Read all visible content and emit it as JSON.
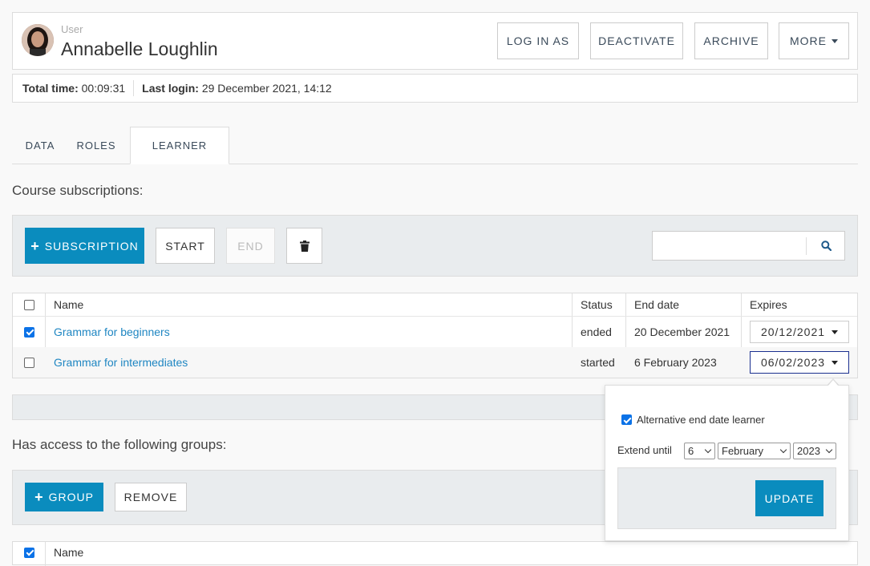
{
  "header": {
    "kicker": "User",
    "name": "Annabelle Loughlin",
    "buttons": {
      "login_as": "LOG IN AS",
      "deactivate": "DEACTIVATE",
      "archive": "ARCHIVE",
      "more": "MORE"
    }
  },
  "info": {
    "total_time_label": "Total time:",
    "total_time_value": "00:09:31",
    "last_login_label": "Last login:",
    "last_login_value": "29 December 2021, 14:12"
  },
  "tabs": {
    "data": "DATA",
    "roles": "ROLES",
    "learner": "LEARNER",
    "active": "LEARNER"
  },
  "subscriptions": {
    "title": "Course subscriptions:",
    "add_label": "SUBSCRIPTION",
    "start_label": "START",
    "end_label": "END",
    "search_placeholder": "",
    "columns": {
      "name": "Name",
      "status": "Status",
      "end_date": "End date",
      "expires": "Expires"
    },
    "rows": [
      {
        "name": "Grammar for beginners",
        "status": "ended",
        "end_date": "20 December 2021",
        "expires": "20/12/2021",
        "checked": true
      },
      {
        "name": "Grammar for intermediates",
        "status": "started",
        "end_date": "6 February 2023",
        "expires": "06/02/2023",
        "checked": false
      }
    ]
  },
  "groups": {
    "title": "Has access to the following groups:",
    "add_label": "GROUP",
    "remove_label": "REMOVE",
    "column_name": "Name"
  },
  "popover": {
    "alt_end_date_label": "Alternative end date learner",
    "alt_end_date_checked": true,
    "extend_label": "Extend until",
    "day": "6",
    "month": "February",
    "year": "2023",
    "update_label": "UPDATE"
  },
  "colors": {
    "primary": "#0a8cbe",
    "link": "#1f86c2",
    "toolbar_bg": "#e9ecee",
    "checkbox_checked": "#0b72e7"
  }
}
